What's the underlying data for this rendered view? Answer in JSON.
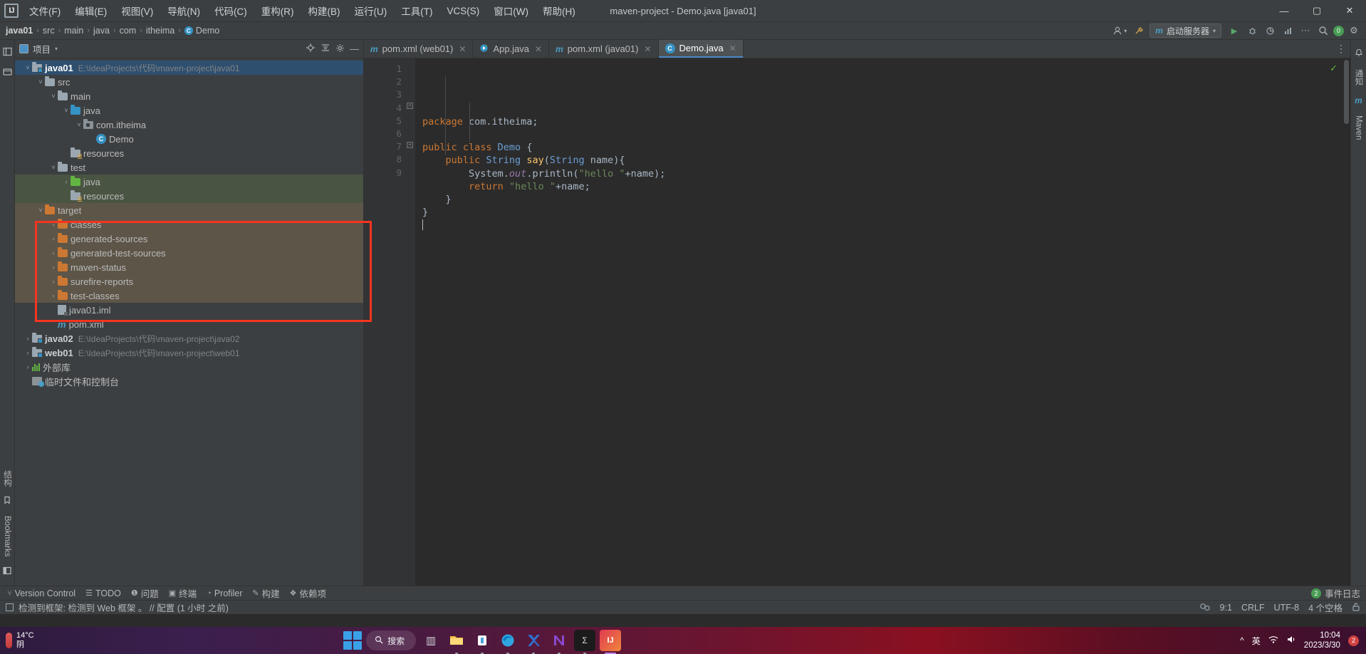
{
  "window": {
    "title": "maven-project - Demo.java [java01]",
    "logo": "IJ",
    "minimize": "—",
    "maximize": "▢",
    "close": "✕"
  },
  "menu": [
    {
      "label": "文件(F)",
      "name": "menu-file"
    },
    {
      "label": "编辑(E)",
      "name": "menu-edit"
    },
    {
      "label": "视图(V)",
      "name": "menu-view"
    },
    {
      "label": "导航(N)",
      "name": "menu-navigate"
    },
    {
      "label": "代码(C)",
      "name": "menu-code"
    },
    {
      "label": "重构(R)",
      "name": "menu-refactor"
    },
    {
      "label": "构建(B)",
      "name": "menu-build"
    },
    {
      "label": "运行(U)",
      "name": "menu-run"
    },
    {
      "label": "工具(T)",
      "name": "menu-tools"
    },
    {
      "label": "VCS(S)",
      "name": "menu-vcs"
    },
    {
      "label": "窗口(W)",
      "name": "menu-window"
    },
    {
      "label": "帮助(H)",
      "name": "menu-help"
    }
  ],
  "breadcrumb": {
    "items": [
      "java01",
      "src",
      "main",
      "java",
      "com",
      "itheima",
      "Demo"
    ],
    "separator": "›",
    "class_badge": "C"
  },
  "navbar_right": {
    "run_config": "启动服务器",
    "run_config_icon": "m",
    "chevron": "▾",
    "account_icon": "account-icon",
    "hammer_icon": "hammer-icon",
    "run_icon": "▶",
    "debug_icon": "debug-icon",
    "coverage_icon": "coverage-icon",
    "profile_icon": "profile-icon",
    "more_icon": "⋯",
    "search_icon": "🔍",
    "notification_count": "0",
    "settings_icon": "⚙"
  },
  "left_strip": {
    "top_items": [
      "结构",
      "书签"
    ],
    "vertical_labels": [
      "结构",
      "Bookmarks"
    ]
  },
  "project_panel": {
    "title": "项目",
    "dropdown": "▾",
    "icons": [
      "target-icon",
      "collapse-all-icon",
      "settings-icon",
      "hide-icon"
    ],
    "tree": [
      {
        "indent": 0,
        "arrow": "v",
        "icon": "module",
        "label": "java01",
        "bold": true,
        "path": "E:\\IdeaProjects\\代码\\maven-project\\java01",
        "state": "selected"
      },
      {
        "indent": 1,
        "arrow": "v",
        "icon": "folder-grey",
        "label": "src",
        "bold": false,
        "path": "",
        "state": ""
      },
      {
        "indent": 2,
        "arrow": "v",
        "icon": "folder-grey",
        "label": "main",
        "bold": false,
        "path": "",
        "state": ""
      },
      {
        "indent": 3,
        "arrow": "v",
        "icon": "folder-blue",
        "label": "java",
        "bold": false,
        "path": "",
        "state": ""
      },
      {
        "indent": 4,
        "arrow": "v",
        "icon": "package",
        "label": "com.itheima",
        "bold": false,
        "path": "",
        "state": ""
      },
      {
        "indent": 5,
        "arrow": "",
        "icon": "class",
        "label": "Demo",
        "bold": false,
        "path": "",
        "state": ""
      },
      {
        "indent": 3,
        "arrow": "",
        "icon": "resources",
        "label": "resources",
        "bold": false,
        "path": "",
        "state": ""
      },
      {
        "indent": 2,
        "arrow": "v",
        "icon": "folder-grey",
        "label": "test",
        "bold": false,
        "path": "",
        "state": ""
      },
      {
        "indent": 3,
        "arrow": ">",
        "icon": "folder-green",
        "label": "java",
        "bold": false,
        "path": "",
        "state": "green"
      },
      {
        "indent": 3,
        "arrow": "",
        "icon": "resources",
        "label": "resources",
        "bold": false,
        "path": "",
        "state": "green"
      },
      {
        "indent": 1,
        "arrow": "v",
        "icon": "folder-orange",
        "label": "target",
        "bold": false,
        "path": "",
        "state": "target"
      },
      {
        "indent": 2,
        "arrow": ">",
        "icon": "folder-orange",
        "label": "classes",
        "bold": false,
        "path": "",
        "state": "target"
      },
      {
        "indent": 2,
        "arrow": ">",
        "icon": "folder-orange",
        "label": "generated-sources",
        "bold": false,
        "path": "",
        "state": "target"
      },
      {
        "indent": 2,
        "arrow": ">",
        "icon": "folder-orange",
        "label": "generated-test-sources",
        "bold": false,
        "path": "",
        "state": "target"
      },
      {
        "indent": 2,
        "arrow": ">",
        "icon": "folder-orange",
        "label": "maven-status",
        "bold": false,
        "path": "",
        "state": "target"
      },
      {
        "indent": 2,
        "arrow": ">",
        "icon": "folder-orange",
        "label": "surefire-reports",
        "bold": false,
        "path": "",
        "state": "target"
      },
      {
        "indent": 2,
        "arrow": ">",
        "icon": "folder-orange",
        "label": "test-classes",
        "bold": false,
        "path": "",
        "state": "target"
      },
      {
        "indent": 2,
        "arrow": "",
        "icon": "iml",
        "label": "java01.iml",
        "bold": false,
        "path": "",
        "state": ""
      },
      {
        "indent": 2,
        "arrow": "",
        "icon": "maven",
        "label": "pom.xml",
        "bold": false,
        "path": "",
        "state": ""
      },
      {
        "indent": 0,
        "arrow": ">",
        "icon": "module",
        "label": "java02",
        "bold": true,
        "path": "E:\\IdeaProjects\\代码\\maven-project\\java02",
        "state": ""
      },
      {
        "indent": 0,
        "arrow": ">",
        "icon": "module",
        "label": "web01",
        "bold": true,
        "path": "E:\\IdeaProjects\\代码\\maven-project\\web01",
        "state": ""
      },
      {
        "indent": 0,
        "arrow": ">",
        "icon": "library",
        "label": "外部库",
        "bold": false,
        "path": "",
        "state": ""
      },
      {
        "indent": 0,
        "arrow": "",
        "icon": "scratch",
        "label": "临时文件和控制台",
        "bold": false,
        "path": "",
        "state": ""
      }
    ]
  },
  "editor": {
    "tabs": [
      {
        "label": "pom.xml (web01)",
        "icon": "maven-icon",
        "active": false,
        "close": "✕"
      },
      {
        "label": "App.java",
        "icon": "java-run-icon",
        "active": false,
        "close": "✕"
      },
      {
        "label": "pom.xml (java01)",
        "icon": "maven-icon",
        "active": false,
        "close": "✕"
      },
      {
        "label": "Demo.java",
        "icon": "java-class-icon",
        "active": true,
        "close": "✕"
      }
    ],
    "line_numbers": [
      "1",
      "2",
      "3",
      "4",
      "5",
      "6",
      "7",
      "8",
      "9"
    ],
    "code_lines": [
      {
        "n": 1,
        "tokens": [
          {
            "t": "package ",
            "c": "kw"
          },
          {
            "t": "com.itheima;",
            "c": "plain"
          }
        ]
      },
      {
        "n": 2,
        "tokens": []
      },
      {
        "n": 3,
        "tokens": [
          {
            "t": "public class ",
            "c": "kw"
          },
          {
            "t": "Demo ",
            "c": "typ"
          },
          {
            "t": "{",
            "c": "plain"
          }
        ]
      },
      {
        "n": 4,
        "tokens": [
          {
            "t": "    public ",
            "c": "kw"
          },
          {
            "t": "String ",
            "c": "typ"
          },
          {
            "t": "say",
            "c": "mth"
          },
          {
            "t": "(",
            "c": "plain"
          },
          {
            "t": "String ",
            "c": "typ"
          },
          {
            "t": "name){",
            "c": "plain"
          }
        ]
      },
      {
        "n": 5,
        "tokens": [
          {
            "t": "        System.",
            "c": "plain"
          },
          {
            "t": "out",
            "c": "fld"
          },
          {
            "t": ".println(",
            "c": "plain"
          },
          {
            "t": "\"hello \"",
            "c": "str"
          },
          {
            "t": "+name);",
            "c": "plain"
          }
        ]
      },
      {
        "n": 6,
        "tokens": [
          {
            "t": "        ",
            "c": "plain"
          },
          {
            "t": "return ",
            "c": "kw"
          },
          {
            "t": "\"hello \"",
            "c": "str"
          },
          {
            "t": "+name;",
            "c": "plain"
          }
        ]
      },
      {
        "n": 7,
        "tokens": [
          {
            "t": "    }",
            "c": "plain"
          }
        ]
      },
      {
        "n": 8,
        "tokens": [
          {
            "t": "}",
            "c": "plain"
          }
        ]
      },
      {
        "n": 9,
        "tokens": []
      }
    ],
    "inspection_status": "✓",
    "more_icon": "⋮"
  },
  "right_strip": {
    "labels": [
      "Maven",
      "通知"
    ]
  },
  "bottom_tool_bar": {
    "items": [
      {
        "label": "Version Control",
        "icon": "branch-icon"
      },
      {
        "label": "TODO",
        "icon": "list-icon"
      },
      {
        "label": "问题",
        "icon": "warning-icon"
      },
      {
        "label": "终端",
        "icon": "terminal-icon"
      },
      {
        "label": "Profiler",
        "icon": "profiler-icon"
      },
      {
        "label": "构建",
        "icon": "hammer-icon"
      },
      {
        "label": "依赖项",
        "icon": "layers-icon"
      }
    ],
    "event_log": "事件日志",
    "event_count": "2"
  },
  "status_bar": {
    "message": "检测到框架: 检测到 Web 框架 。 // 配置 (1 小时 之前)",
    "caret_position": "9:1",
    "line_separator": "CRLF",
    "encoding": "UTF-8",
    "indent": "4 个空格",
    "lock_icon": "🔓",
    "inspector_icon": "inspections-icon"
  },
  "taskbar": {
    "weather_temp": "14°C",
    "weather_desc": "阴",
    "search_placeholder": "搜索",
    "search_icon": "🔍",
    "apps": [
      {
        "name": "taskbar-file-explorer-dark",
        "glyph": "▥",
        "color": "#cfd2d6"
      },
      {
        "name": "taskbar-file-explorer",
        "glyph": "📁",
        "color": "#f7c04a"
      },
      {
        "name": "taskbar-store",
        "glyph": "🛍",
        "color": "#4a9ee0"
      },
      {
        "name": "taskbar-edge",
        "glyph": "◉",
        "color": "#2fa6e0"
      },
      {
        "name": "taskbar-xmind",
        "glyph": "✘",
        "color": "#2f6fd0"
      },
      {
        "name": "taskbar-navicat",
        "glyph": "Ν",
        "color": "#8a4ad0"
      },
      {
        "name": "taskbar-cmd",
        "glyph": "Σ",
        "color": "#1b1b1b"
      },
      {
        "name": "taskbar-intellij-idea",
        "glyph": "IJ",
        "color": "#e03a52"
      }
    ],
    "tray_icons": [
      "^",
      "输入法",
      "网络",
      "音量"
    ],
    "clock_time": "10:04",
    "clock_date": "2023/3/30",
    "notification_count": "2"
  },
  "colors": {
    "accent_blue": "#3592c4",
    "folder_orange": "#cc7832",
    "folder_green": "#62b543",
    "highlight_red": "#f5341f",
    "string_green": "#6a8759",
    "keyword_orange": "#cc7832",
    "panel_bg": "#3c3f41",
    "editor_bg": "#2b2b2b"
  }
}
